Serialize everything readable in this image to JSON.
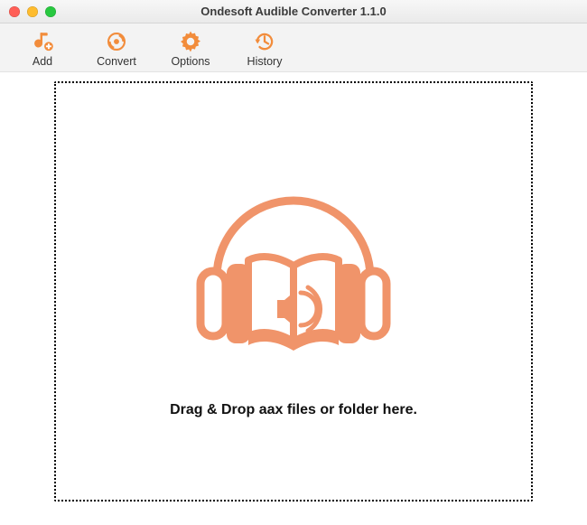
{
  "accent": "#f28c3b",
  "window": {
    "title": "Ondesoft Audible Converter 1.1.0"
  },
  "toolbar": {
    "items": [
      {
        "id": "add",
        "label": "Add",
        "icon": "music-add-icon"
      },
      {
        "id": "convert",
        "label": "Convert",
        "icon": "convert-icon"
      },
      {
        "id": "options",
        "label": "Options",
        "icon": "gear-icon"
      },
      {
        "id": "history",
        "label": "History",
        "icon": "history-icon"
      }
    ]
  },
  "dropzone": {
    "message": "Drag & Drop aax files or folder here.",
    "art": "audiobook-headphones-icon"
  }
}
